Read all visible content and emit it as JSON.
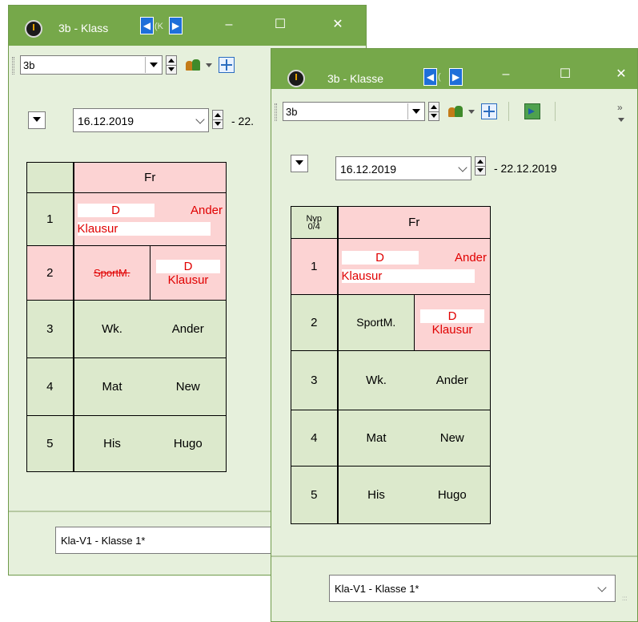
{
  "colors": {
    "titlebar": "#76a84a",
    "window_bg": "#e6f0dc",
    "highlight_red": "#fcd3d3",
    "cell_green": "#dce9cc",
    "text_red": "#e00000"
  },
  "back_window": {
    "title": "3b - Klass",
    "title_suffix": "(K",
    "class_value": "3b",
    "date_start": "16.12.2019",
    "date_end": "- 22.",
    "bottom_value": "Kla-V1 - Klasse 1*",
    "day": "Fr",
    "rows": [
      {
        "num": "1",
        "a": "D",
        "b": "Ander",
        "c": "Klausur"
      },
      {
        "num": "2",
        "a": "SportM.",
        "b": "D",
        "c": "Klausur"
      },
      {
        "num": "3",
        "a": "Wk.",
        "b": "Ander"
      },
      {
        "num": "4",
        "a": "Mat",
        "b": "New"
      },
      {
        "num": "5",
        "a": "His",
        "b": "Hugo"
      }
    ]
  },
  "front_window": {
    "title": "3b - Klasse",
    "title_suffix": "(",
    "class_value": "3b",
    "date_start": "16.12.2019",
    "date_end": "- 22.12.2019",
    "corner_label_1": "Nyp",
    "corner_label_2": "0/4",
    "bottom_value": "Kla-V1 - Klasse 1*",
    "day": "Fr",
    "rows": [
      {
        "num": "1",
        "a": "D",
        "b": "Ander",
        "c": "Klausur"
      },
      {
        "num": "2",
        "a": "SportM.",
        "b": "D",
        "c": "Klausur"
      },
      {
        "num": "3",
        "a": "Wk.",
        "b": "Ander"
      },
      {
        "num": "4",
        "a": "Mat",
        "b": "New"
      },
      {
        "num": "5",
        "a": "His",
        "b": "Hugo"
      }
    ]
  },
  "window_buttons": {
    "minimize": "–",
    "maximize": "☐",
    "close": "✕"
  },
  "toolbar_overflow": "»"
}
